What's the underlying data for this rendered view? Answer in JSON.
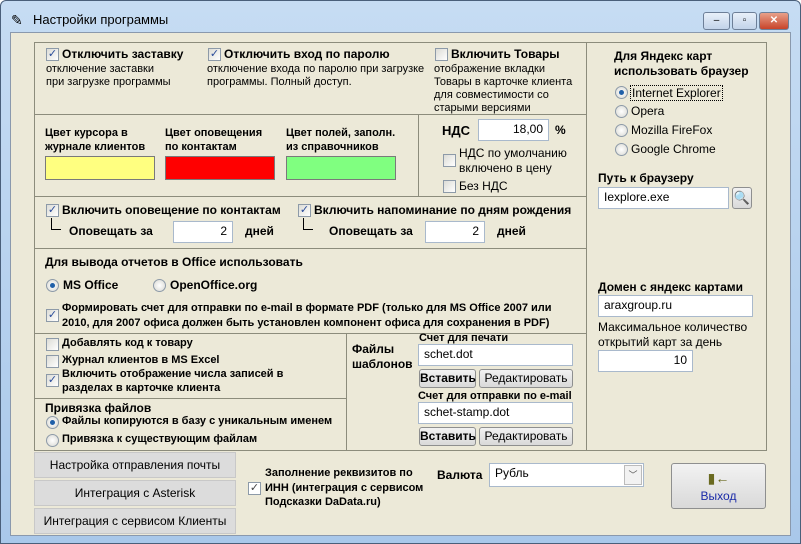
{
  "window": {
    "title": "Настройки программы",
    "minimize": "‒",
    "maximize": "▫",
    "close": "✕"
  },
  "general": {
    "disable_splash": {
      "label": "Отключить заставку",
      "desc1": "отключение заставки",
      "desc2": "при загрузке программы",
      "checked": true
    },
    "disable_password": {
      "label": "Отключить вход по паролю",
      "desc1": "отключение входа по паролю при загрузке",
      "desc2": "программы. Полный доступ.",
      "checked": true
    },
    "enable_goods": {
      "label": "Включить Товары",
      "desc1": "отображение вкладки",
      "desc2": "Товары в карточке клиента",
      "desc3": "для совместимости со",
      "desc4": "старыми версиями",
      "checked": false
    }
  },
  "colors": [
    {
      "l1": "Цвет курсора в",
      "l2": "журнале клиентов",
      "color": "#ffff80"
    },
    {
      "l1": "Цвет оповещения",
      "l2": "по контактам",
      "color": "#ff0000"
    },
    {
      "l1": "Цвет полей, заполн.",
      "l2": "из справочников",
      "color": "#80ff80"
    }
  ],
  "vat": {
    "label": "НДС",
    "value": "18,00",
    "unit": "%",
    "default_l1": "НДС по умолчанию",
    "default_l2": "включено в цену",
    "no_vat": "Без НДС"
  },
  "notify": {
    "contacts": {
      "label": "Включить оповещение по контактам",
      "sub": "Оповещать за",
      "value": "2",
      "unit": "дней"
    },
    "birthdays": {
      "label": "Включить напоминание по дням рождения",
      "sub": "Оповещать за",
      "value": "2",
      "unit": "дней"
    }
  },
  "office": {
    "title": "Для вывода отчетов в Office использовать",
    "ms": "MS Office",
    "oo": "OpenOffice.org",
    "pdf_l1": "Формировать счет для отправки по e-mail в формате PDF (только для MS Office 2007 или",
    "pdf_l2": "2010, для 2007 офиса должен быть установлен компонент офиса для  сохранения в PDF)"
  },
  "misc": {
    "add_code": "Добавлять код к товару",
    "excel": "Журнал клиентов в MS Excel",
    "count_l1": "Включить отображение числа записей в",
    "count_l2": "разделах в карточке клиента"
  },
  "files": {
    "title": "Привязка файлов",
    "opt1": "Файлы копируются в базу с уникальным именем",
    "opt2": "Привязка к существующим файлам"
  },
  "templates": {
    "title1": "Файлы",
    "title2": "шаблонов",
    "print_label": "Счет для печати",
    "print_value": "schet.dot",
    "email_label": "Счет для отправки по e-mail",
    "email_value": "schet-stamp.dot",
    "insert": "Вставить",
    "edit": "Редактировать"
  },
  "browser": {
    "title1": "Для Яндекс карт",
    "title2": "использовать браузер",
    "options": [
      "Internet Explorer",
      "Opera",
      "Mozilla FireFox",
      "Google Chrome"
    ],
    "path_label": "Путь к браузеру",
    "path_value": "Iexplore.exe",
    "domain_label": "Домен с яндекс картами",
    "domain_value": "araxgroup.ru",
    "max_l1": "Максимальное количество",
    "max_l2": "открытий карт за день",
    "max_value": "10"
  },
  "bottom": {
    "mail": "Настройка отправления почты",
    "asterisk": "Интеграция с Asterisk",
    "clients": "Интеграция с сервисом Клиенты",
    "dadata_l1": "Заполнение реквизитов по",
    "dadata_l2": "ИНН (интеграция с сервисом",
    "dadata_l3": "Подсказки DaData.ru)",
    "currency_label": "Валюта",
    "currency_value": "Рубль",
    "exit": "Выход"
  }
}
